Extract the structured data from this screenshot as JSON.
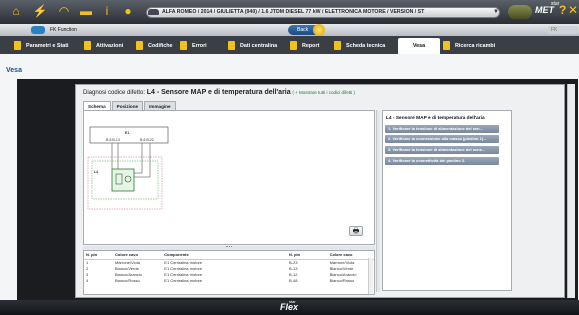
{
  "topbar": {
    "vehicle": "ALFA ROMEO / 2014 / GIULIETTA (940) / 1.6 JTDM DIESEL 77 kW / ELETTRONICA MOTORE / VERSION / ST",
    "logo": "MET",
    "logo_star": "star",
    "icons": [
      "home-icon",
      "car-icon",
      "wifi-icon",
      "folder-icon",
      "info-icon",
      "globe-icon",
      "help-icon",
      "tools-icon"
    ]
  },
  "subbar": {
    "functions_label": "FK Function",
    "back_label": "Back",
    "right_label": "FK"
  },
  "tabs": [
    "Parametri e Stati",
    "Attivazioni",
    "Codifiche",
    "Errori",
    "Dati centralina",
    "Report",
    "Scheda tecnica",
    "Vesa",
    "Ricerca ricambi"
  ],
  "active_tab": "Vesa",
  "page_title": "Vesa",
  "diagnosis": {
    "label": "Diagnosi codice difetto:",
    "code_title": "L4 - Sensore MAP e di temperatura dell'aria",
    "show_all": "( + Mostrare tutti i codici difetti )"
  },
  "inner_tabs": [
    "Schema",
    "Posizione",
    "Immagine"
  ],
  "schema": {
    "ecu_label": "E1",
    "pins_left": "B-8  B-13",
    "pins_right": "B-6  B-22",
    "sensor_label": "L4"
  },
  "right_panel": {
    "title": "L4 - Sensore MAP e di temperatura dell'aria",
    "steps": [
      "1. Verificare la tensione di alimentazione del sen...",
      "2. Verificare la connessione alla massa (piedino 1)...",
      "3. Verificare la tensione di alimentazione del sens...",
      "4. Verificare la connettività del piedino 3."
    ]
  },
  "pin_table": {
    "headers": [
      "N. pin",
      "Colore cavo",
      "Componente",
      "N. pin",
      "Colore cavo"
    ],
    "rows": [
      [
        "1",
        "Marrone/Viola",
        "E1 Centralina motore",
        "B-23",
        "Marrone/Viola"
      ],
      [
        "2",
        "Bianco/Verde",
        "E1 Centralina motore",
        "B-13",
        "Bianco/Verde"
      ],
      [
        "3",
        "Bianco/Arancio",
        "E1 Centralina motore",
        "B-12",
        "Bianco/Arancio"
      ],
      [
        "4",
        "Bianco/Rosso",
        "E1 Centralina motore",
        "B-48",
        "Bianco/Rosso"
      ]
    ]
  },
  "footer": {
    "logo": "Flex",
    "logo_star": "star"
  },
  "colors": {
    "accent": "#f3c21a",
    "tabbar": "#3a3f46",
    "title_blue": "#1f4e8a",
    "step_bg": "#8796aa"
  }
}
